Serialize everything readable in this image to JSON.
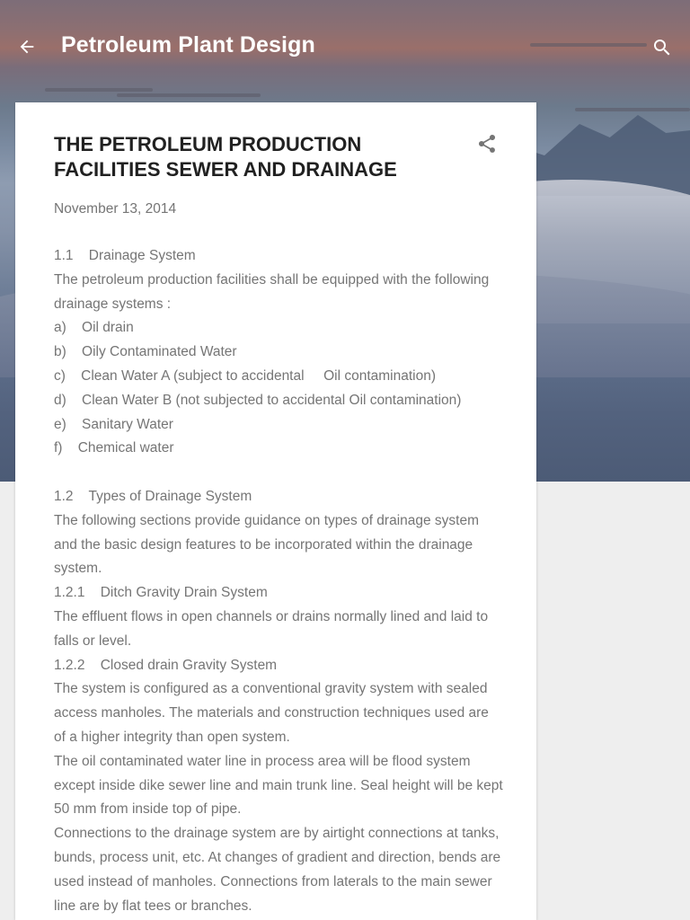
{
  "header": {
    "blog_title": "Petroleum Plant Design",
    "back_icon": "arrow-left-icon",
    "search_icon": "search-icon",
    "text_color": "#ffffff"
  },
  "post": {
    "title": "THE PETROLEUM PRODUCTION FACILITIES SEWER AND DRAINAGE",
    "date": "November 13, 2014",
    "share_icon": "share-icon",
    "body": {
      "s1_heading": "1.1    Drainage System",
      "s1_intro": "The petroleum production facilities shall be equipped with the following drainage systems :",
      "s1_items": [
        "a)    Oil drain",
        "b)    Oily Contaminated Water",
        "c)    Clean Water A (subject to accidental     Oil contamination)",
        "d)    Clean Water B (not subjected to accidental Oil contamination)",
        "e)    Sanitary Water",
        "f)    Chemical water"
      ],
      "s2_heading": "1.2    Types of Drainage System",
      "s2_intro": "The following sections provide guidance on types of drainage system and the basic design features to be incorporated within the drainage system.",
      "s2_1_heading": "1.2.1    Ditch Gravity Drain System",
      "s2_1_text": "The effluent flows in open channels or drains normally lined and laid to falls or level.",
      "s2_2_heading": "1.2.2    Closed drain Gravity System",
      "s2_2_p1": "The system is configured as a conventional gravity system with sealed access manholes.  The materials and construction techniques used are of a higher integrity than open system.",
      "s2_2_p2": "The oil contaminated water line in process area will be flood system except inside dike sewer line and main trunk line. Seal height will be kept 50 mm from inside top of pipe.",
      "s2_2_p3": "Connections to the drainage system are by airtight connections at tanks, bunds, process unit, etc. At changes of gradient and direction, bends are used instead of manholes. Connections from laterals to the main sewer line are by flat tees or branches."
    }
  },
  "colors": {
    "page_background": "#eeeeee",
    "card_background": "#ffffff",
    "title_text": "#212121",
    "body_text": "#757575"
  }
}
